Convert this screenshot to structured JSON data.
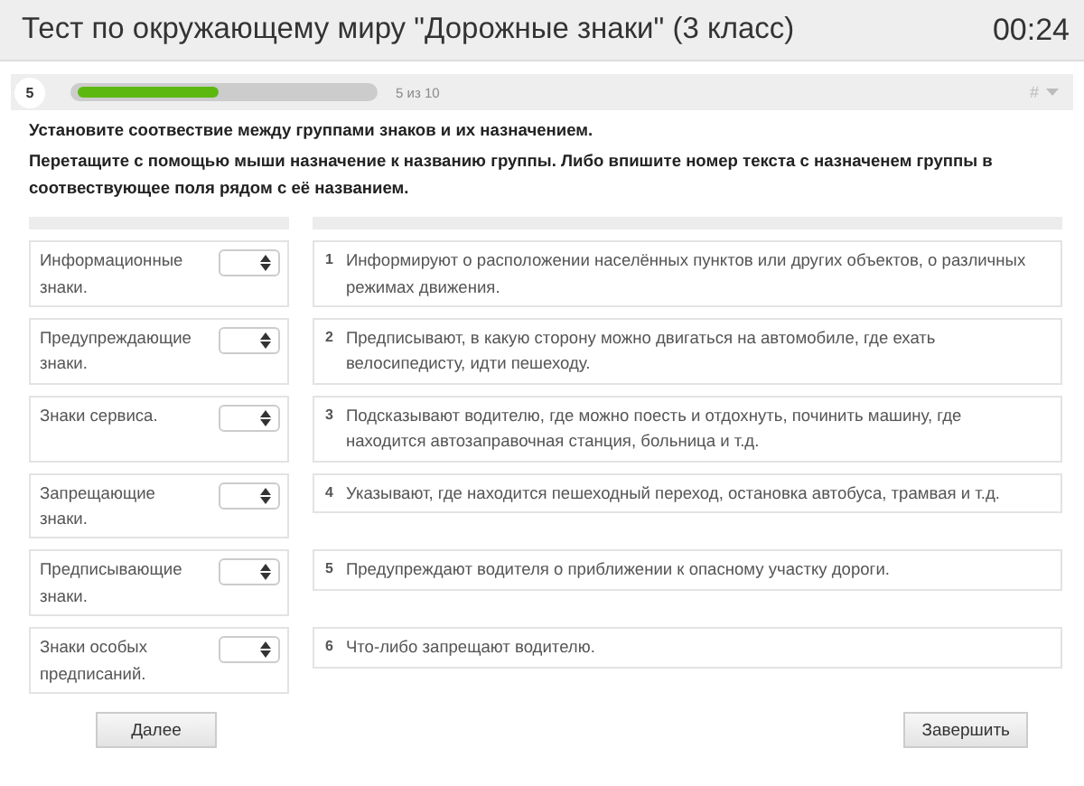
{
  "header": {
    "title": "Тест по окружающему миру \"Дорожные знаки\" (3 класс)",
    "timer": "00:24"
  },
  "progress": {
    "question_number": "5",
    "level": 0.48,
    "counter": "5 из 10",
    "menu_label": "#"
  },
  "instructions": [
    "Установите соотвествие между группами знаков и их назначением.",
    "Перетащите с помощью мыши назначение к названию группы. Либо впишите номер текста с  назначенем группы в соотвествующее поля рядом с её названием."
  ],
  "groups": [
    {
      "name": "Информационные знаки."
    },
    {
      "name": "Предупреждающие знаки."
    },
    {
      "name": "Знаки сервиса."
    },
    {
      "name": "Запрещающие знаки."
    },
    {
      "name": "Предписывающие знаки."
    },
    {
      "name": "Знаки особых предписаний."
    }
  ],
  "purposes": [
    {
      "number": "1",
      "text": "Информируют о расположении населённых пунктов или других объектов, о различных режимах движения."
    },
    {
      "number": "2",
      "text": "Предписывают, в какую сторону можно двигаться на автомобиле, где ехать велосипедисту, идти пешеходу."
    },
    {
      "number": "3",
      "text": "Подсказывают водителю, где можно поесть и отдохнуть, починить машину, где находится автозаправочная станция, больница и т.д."
    },
    {
      "number": "4",
      "text": "Указывают, где находится пешеходный переход, остановка автобуса, трамвая и т.д."
    },
    {
      "number": "5",
      "text": "Предупреждают водителя о приближении к опасному участку дороги."
    },
    {
      "number": "6",
      "text": "Что-либо запрещают водителю."
    }
  ],
  "buttons": {
    "next": "Далее",
    "finish": "Завершить"
  }
}
